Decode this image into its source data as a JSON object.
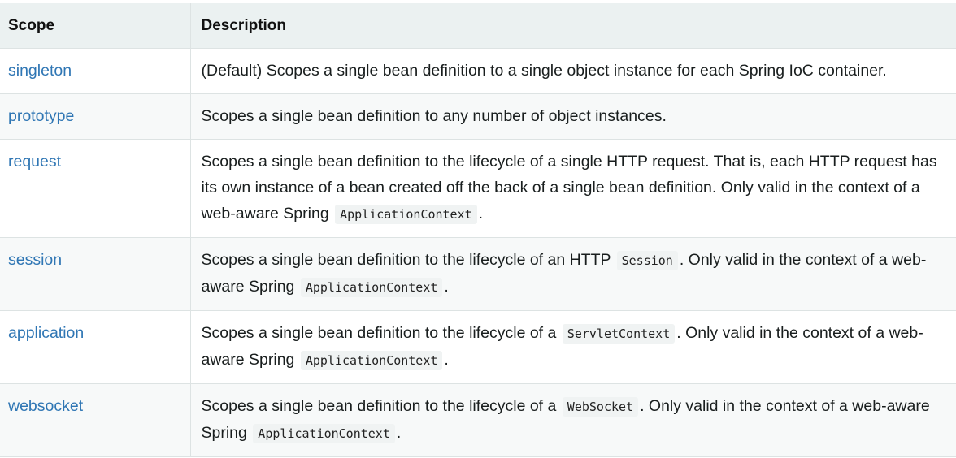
{
  "headers": {
    "scope": "Scope",
    "description": "Description"
  },
  "rows": [
    {
      "scope": "singleton",
      "parts": [
        "(Default) Scopes a single bean definition to a single object instance for each Spring IoC container."
      ]
    },
    {
      "scope": "prototype",
      "parts": [
        "Scopes a single bean definition to any number of object instances."
      ]
    },
    {
      "scope": "request",
      "parts": [
        "Scopes a single bean definition to the lifecycle of a single HTTP request. That is, each HTTP request has its own instance of a bean created off the back of a single bean definition. Only valid in the context of a web-aware Spring",
        "ApplicationContext",
        "."
      ]
    },
    {
      "scope": "session",
      "parts": [
        "Scopes a single bean definition to the lifecycle of an HTTP",
        "Session",
        ". Only valid in the context of a web-aware Spring",
        "ApplicationContext",
        "."
      ]
    },
    {
      "scope": "application",
      "parts": [
        "Scopes a single bean definition to the lifecycle of a",
        "ServletContext",
        ". Only valid in the context of a web-aware Spring",
        "ApplicationContext",
        "."
      ]
    },
    {
      "scope": "websocket",
      "parts": [
        "Scopes a single bean definition to the lifecycle of a",
        "WebSocket",
        ". Only valid in the context of a web-aware Spring",
        "ApplicationContext",
        "."
      ]
    }
  ]
}
